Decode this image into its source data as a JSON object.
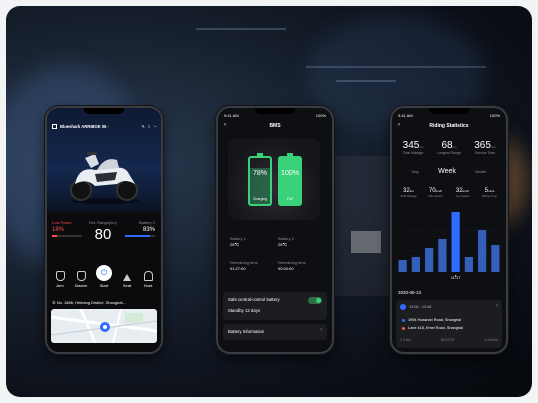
{
  "colors": {
    "accent": "#2f6bff",
    "green": "#39d27a",
    "red": "#ff4b4b",
    "card": "#1c1d21"
  },
  "phone1": {
    "status_time": "9:41 AM",
    "status_batt": "100%",
    "title": "Blueshark ARRIBOE 05 ·",
    "left_label": "Low Power",
    "left_value": "18%",
    "mid_label": "Est. Range(km)",
    "mid_value": "80",
    "right_label": "Battery 2",
    "right_value": "83%",
    "actions": [
      {
        "label": "Arm",
        "icon": "arm-icon"
      },
      {
        "label": "Disarm",
        "icon": "disarm-icon"
      },
      {
        "label": "Start",
        "icon": "power-icon"
      },
      {
        "label": "Seat",
        "icon": "seat-icon"
      },
      {
        "label": "Hunt",
        "icon": "hunt-icon"
      }
    ],
    "address": "⑤ No. 1886, Hinhang District, Shanghai..."
  },
  "phone2": {
    "status_time": "9:41 AM",
    "status_batt": "100%",
    "title": "BMS",
    "b1_pct": "78%",
    "b1_state": "Charging",
    "b1_level": 0.78,
    "b2_pct": "100%",
    "b2_state": "Full",
    "b2_level": 1.0,
    "b1_label": "Battery 1",
    "b1_temp": "28℃",
    "b2_label": "Battery 2",
    "b2_temp": "28℃",
    "rt1_label": "Remaining time",
    "rt1_value": "01:27:00",
    "rt2_label": "Remaining time",
    "rt2_value": "00:00:00",
    "safe_title": "Safe central-control battery",
    "standby": "Standby 12 days",
    "info": "Battery Information"
  },
  "phone3": {
    "status_time": "9:41 AM",
    "status_batt": "100%",
    "title": "Riding Statistics",
    "stats": [
      {
        "value": "345",
        "unit": "km",
        "label": "Total Mileage"
      },
      {
        "value": "68",
        "unit": "km",
        "label": "Longest Range"
      },
      {
        "value": "365",
        "unit": "min",
        "label": "Service Time"
      }
    ],
    "tabs": [
      "Day",
      "Week",
      "Month"
    ],
    "metrics": [
      {
        "value": "32",
        "unit": "km",
        "label": "Total Mileage"
      },
      {
        "value": "70",
        "unit": "km/h",
        "label": "Max Speed"
      },
      {
        "value": "32",
        "unit": "km/h",
        "label": "Avg Speed"
      },
      {
        "value": "5",
        "unit": "mins",
        "label": "Riding Time"
      }
    ],
    "date": "2020-06-13",
    "trip_time": "13:06 - 13:46",
    "from": "1994 Huashan Road, Shanghai",
    "to": "Lane 418, Emei Road, Shanghai",
    "trip_stats": [
      "1.2 km",
      "00:07:57",
      "0.9 km/h"
    ]
  },
  "chart_data": {
    "type": "bar",
    "categories": [
      "",
      "",
      "",
      "",
      "11-17",
      "",
      "",
      ""
    ],
    "values": [
      0.2,
      0.25,
      0.4,
      0.55,
      1.0,
      0.25,
      0.7,
      0.45
    ],
    "highlight_index": 4
  }
}
